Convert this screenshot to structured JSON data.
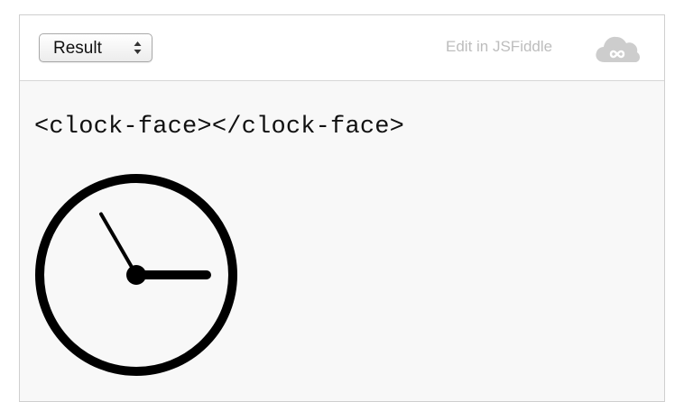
{
  "toolbar": {
    "select_value": "Result",
    "edit_link": "Edit in JSFiddle"
  },
  "result": {
    "code_text": "<clock-face></clock-face>",
    "clock": {
      "hour": 3,
      "minute": 55
    }
  },
  "colors": {
    "frame_border": "#cfcfcf",
    "content_bg": "#f8f8f8",
    "link_text": "#bdbdbd",
    "cloud_icon": "#cdcdcd",
    "clock_ink": "#000000"
  },
  "icons": {
    "select_arrows": "updown-arrows-icon",
    "cloud": "jsfiddle-cloud-icon"
  }
}
